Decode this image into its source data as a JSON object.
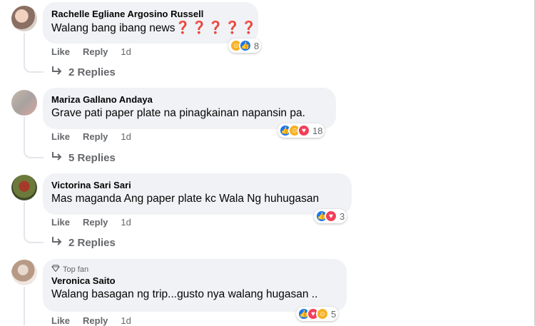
{
  "comments": [
    {
      "author": "Rachelle Egliane Argosino Russell",
      "text": "Walang bang ibang news",
      "emoji": "❓❓❓❓❓",
      "like": "Like",
      "reply": "Reply",
      "time": "1d",
      "count": "8",
      "replies": "2 Replies"
    },
    {
      "author": "Mariza Gallano Andaya",
      "text": "Grave pati paper plate na pinagkainan napansin pa.",
      "like": "Like",
      "reply": "Reply",
      "time": "1d",
      "count": "18",
      "replies": "5 Replies"
    },
    {
      "author": "Victorina Sari Sari",
      "text": "Mas maganda Ang paper plate kc Wala Ng huhugasan",
      "like": "Like",
      "reply": "Reply",
      "time": "1d",
      "count": "3",
      "replies": "2 Replies"
    },
    {
      "author": "Veronica Saito",
      "badge": "Top fan",
      "text": "Walang basagan ng trip...gusto nya walang hugasan ..",
      "like": "Like",
      "reply": "Reply",
      "time": "1d",
      "count": "5"
    }
  ],
  "icons": {
    "reply_arrow": "reply-arrow-icon",
    "diamond": "diamond-icon"
  }
}
